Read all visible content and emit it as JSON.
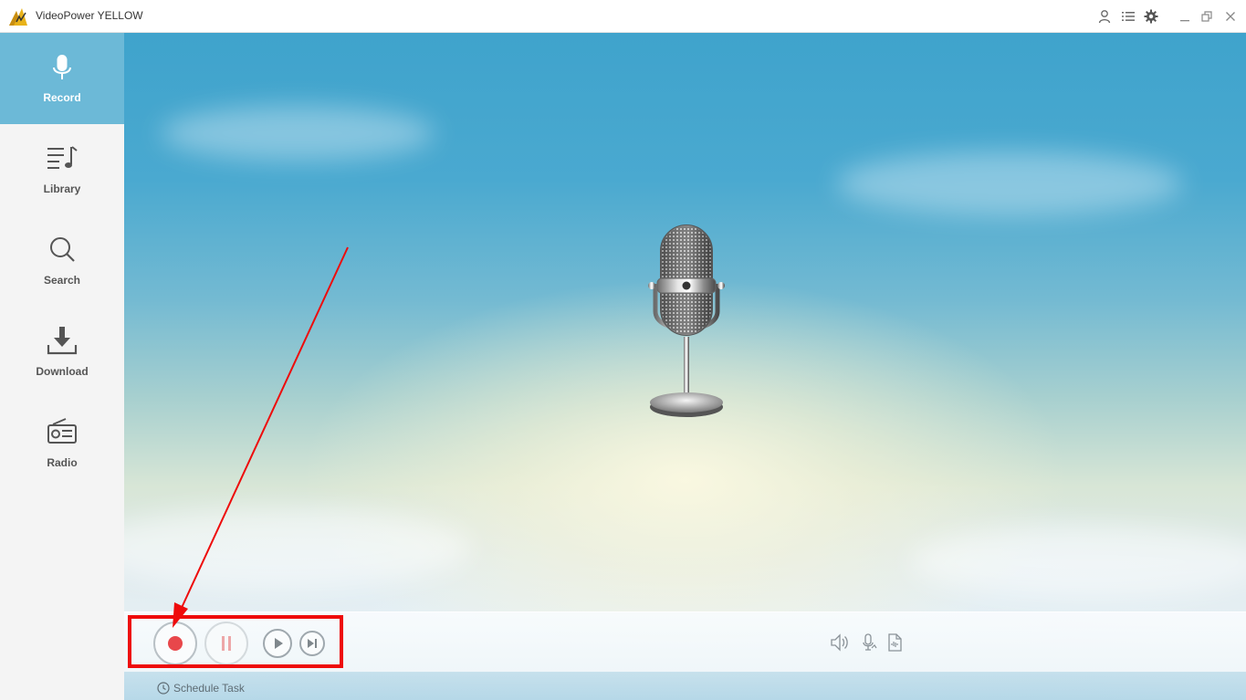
{
  "window": {
    "title": "VideoPower YELLOW",
    "toolbar_icons": [
      "user-icon",
      "menu-list-icon",
      "gear-icon"
    ],
    "window_controls": [
      "minimize-icon",
      "restore-icon",
      "close-icon"
    ]
  },
  "sidebar": {
    "items": [
      {
        "label": "Record",
        "icon": "microphone-icon",
        "active": true
      },
      {
        "label": "Library",
        "icon": "music-list-icon",
        "active": false
      },
      {
        "label": "Search",
        "icon": "search-icon",
        "active": false
      },
      {
        "label": "Download",
        "icon": "download-icon",
        "active": false
      },
      {
        "label": "Radio",
        "icon": "radio-icon",
        "active": false
      }
    ]
  },
  "player": {
    "buttons": [
      "record-icon",
      "pause-icon",
      "play-icon",
      "skip-next-icon"
    ],
    "right_icons": [
      "speaker-icon",
      "microphone-source-icon",
      "audio-format-icon"
    ],
    "schedule_label": "Schedule Task"
  },
  "colors": {
    "sidebar_active": "#6cb9d7",
    "record_red": "#e8474b",
    "annotation_red": "#ee0b0b"
  }
}
